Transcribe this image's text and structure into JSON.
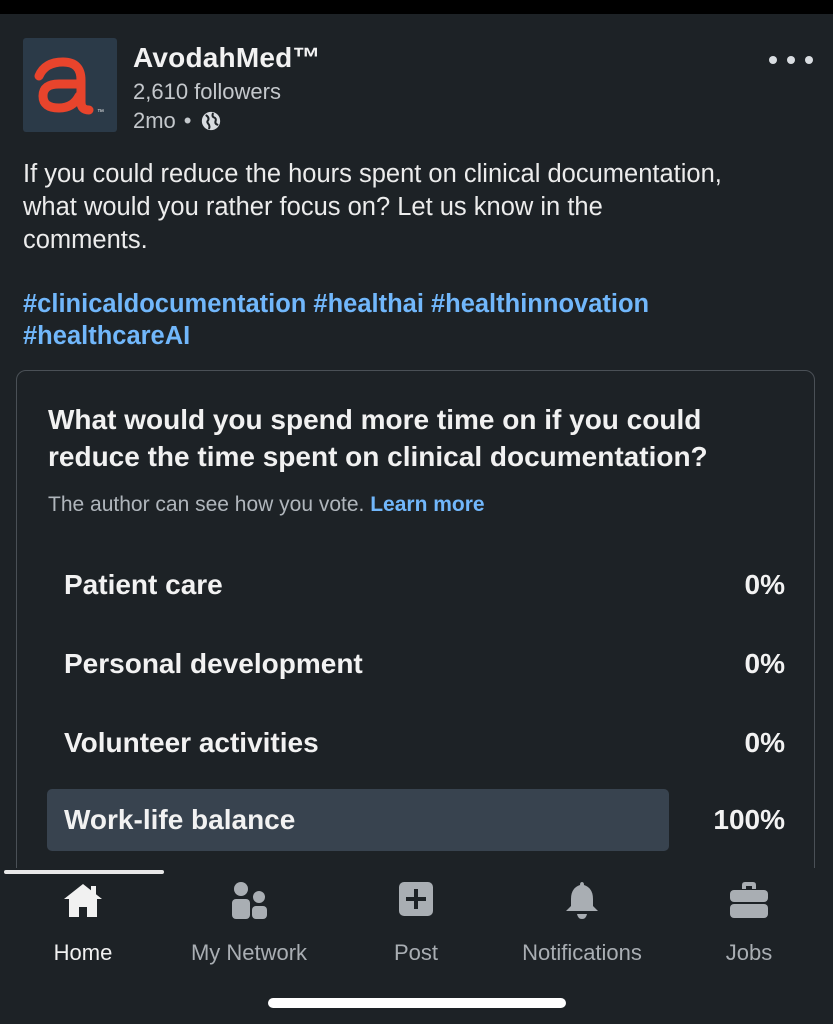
{
  "post": {
    "company_name": "AvodahMed™",
    "followers": "2,610 followers",
    "time": "2mo",
    "separator": "•",
    "body_line1": "If you could reduce the hours spent on clinical documentation,",
    "body_line2": "what would you rather focus on? Let us know in the",
    "body_line3": "comments.",
    "hashtags": [
      "#clinicaldocumentation",
      "#healthai",
      "#healthinnovation",
      "#healthcareAI"
    ],
    "logo_letter": "a",
    "logo_tm": "™",
    "logo_accent": "#e8442c"
  },
  "poll": {
    "question": "What would you spend more time on if you could reduce the time spent on clinical documentation?",
    "note": "The author can see how you vote.",
    "learn_more": "Learn more",
    "options": [
      {
        "label": "Patient care",
        "percent_text": "0%",
        "fraction": 0,
        "selected": false
      },
      {
        "label": "Personal development",
        "percent_text": "0%",
        "fraction": 0,
        "selected": false
      },
      {
        "label": "Volunteer activities",
        "percent_text": "0%",
        "fraction": 0,
        "selected": false
      },
      {
        "label": "Work-life balance",
        "percent_text": "100%",
        "fraction": 1,
        "selected": true
      }
    ]
  },
  "nav": {
    "items": [
      {
        "label": "Home",
        "icon": "home-icon",
        "active": true
      },
      {
        "label": "My Network",
        "icon": "network-icon",
        "active": false
      },
      {
        "label": "Post",
        "icon": "post-icon",
        "active": false
      },
      {
        "label": "Notifications",
        "icon": "bell-icon",
        "active": false
      },
      {
        "label": "Jobs",
        "icon": "briefcase-icon",
        "active": false
      }
    ]
  },
  "colors": {
    "background": "#1d2226",
    "link": "#71b7fb",
    "poll_bar": "#38434f"
  }
}
